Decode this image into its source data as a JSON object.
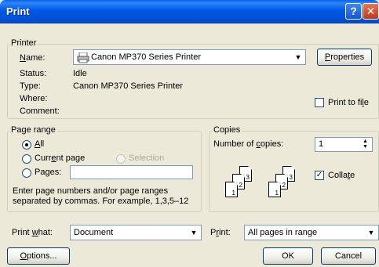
{
  "window": {
    "title": "Print",
    "help_symbol": "?",
    "close_symbol": "✕"
  },
  "printer": {
    "group_label": "Printer",
    "name_label": "Name:",
    "name_value": "Canon MP370 Series Printer",
    "properties_label": "Properties",
    "status_label": "Status:",
    "status_value": "Idle",
    "type_label": "Type:",
    "type_value": "Canon MP370 Series Printer",
    "where_label": "Where:",
    "comment_label": "Comment:",
    "print_to_file_label": "Print to file"
  },
  "page_range": {
    "group_label": "Page range",
    "all_label": "All",
    "current_page_label": "Current page",
    "selection_label": "Selection",
    "pages_label": "Pages:",
    "hint_line1": "Enter page numbers and/or page ranges",
    "hint_line2": "separated by commas.  For example, 1,3,5–12"
  },
  "copies": {
    "group_label": "Copies",
    "number_label": "Number of copies:",
    "number_value": "1",
    "collate_label": "Collate",
    "page_numbers": [
      "3",
      "2",
      "1",
      "3",
      "2",
      "1"
    ]
  },
  "bottom": {
    "print_what_label": "Print what:",
    "print_what_value": "Document",
    "print_label": "Print:",
    "print_value": "All pages in range",
    "options_label": "Options...",
    "ok_label": "OK",
    "cancel_label": "Cancel"
  }
}
